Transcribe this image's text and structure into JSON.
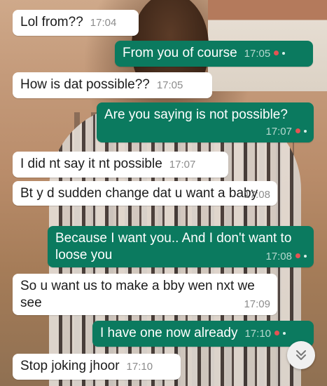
{
  "messages": [
    {
      "dir": "in",
      "text": "Lol from??",
      "time": "17:04"
    },
    {
      "dir": "out",
      "text": "From you of course",
      "time": "17:05"
    },
    {
      "dir": "in",
      "text": "How is dat possible??",
      "time": "17:05"
    },
    {
      "dir": "out",
      "text": "Are you saying is not possible?",
      "time": "17:07"
    },
    {
      "dir": "in",
      "text": "I did nt say it nt possible",
      "time": "17:07"
    },
    {
      "dir": "in",
      "text": "Bt y d sudden change dat u want a baby",
      "time": "17:08"
    },
    {
      "dir": "out",
      "text": "Because I want you.. And I don't want to loose you",
      "time": "17:08"
    },
    {
      "dir": "in",
      "text": "So u want us to make a bby wen nxt we see",
      "time": "17:09"
    },
    {
      "dir": "out",
      "text": "I have one now already",
      "time": "17:10"
    },
    {
      "dir": "in",
      "text": "Stop joking jhoor",
      "time": "17:10"
    }
  ],
  "scroll_button": {
    "icon": "double-chevron-down-icon"
  },
  "colors": {
    "incoming": "#ffffff",
    "outgoing": "#0b7a5f",
    "status_dot": "#e55353"
  }
}
